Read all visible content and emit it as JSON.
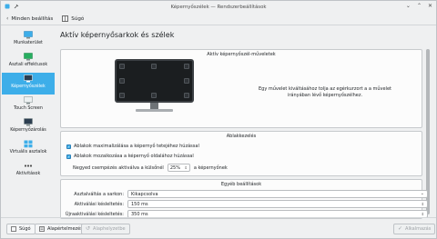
{
  "window": {
    "title": "Képernyőszélek — Rendszerbeállítások"
  },
  "toolbar": {
    "back_label": "Minden beállítás",
    "help_label": "Súgó"
  },
  "sidebar": {
    "items": [
      {
        "label": "Munkaterület",
        "icon": "workspace-icon"
      },
      {
        "label": "Asztali effektusok",
        "icon": "desktop-effects-icon"
      },
      {
        "label": "Képernyőszélek",
        "icon": "screen-edges-icon",
        "active": true
      },
      {
        "label": "Touch Screen",
        "icon": "touch-screen-icon"
      },
      {
        "label": "Képernyőzárolás",
        "icon": "screen-lock-icon"
      },
      {
        "label": "Virtuális asztalok",
        "icon": "virtual-desktops-icon"
      },
      {
        "label": "Aktivitások",
        "icon": "activities-icon"
      }
    ]
  },
  "main": {
    "title": "Aktív képernyősarkok és szélek",
    "active_edges": {
      "title": "Aktív képernyőszél-műveletek",
      "hint": "Egy művelet kiváltásához tolja az egérkurzort a a művelet irányában lévő képernyőszélhez."
    },
    "window_management": {
      "title": "Ablakkezelés",
      "maximize_label": "Ablakok maximalizálása a képernyő tetejéhez húzással",
      "tile_label": "Ablakok mozaikozása a képernyő oldalához húzással",
      "quarter_prefix": "Negyed csempézés aktiválva a külsőnél",
      "quarter_value": "25%",
      "quarter_suffix": "a képernyőnek"
    },
    "other": {
      "title": "Egyéb beállítások",
      "switch_label": "Asztalváltás a sarkon:",
      "switch_value": "Kikapcsolva",
      "delay_label": "Aktiválási késleltetés:",
      "delay_value": "150 ms",
      "reactivation_label": "Újraaktiválási késleltetés:",
      "reactivation_value": "350 ms"
    }
  },
  "footer": {
    "help_label": "Súgó",
    "defaults_label": "Alapértelmezés",
    "reset_label": "Alaphelyzetbe",
    "apply_label": "Alkalmazás"
  },
  "colors": {
    "accent": "#3daee9",
    "background": "#eff0f1"
  }
}
